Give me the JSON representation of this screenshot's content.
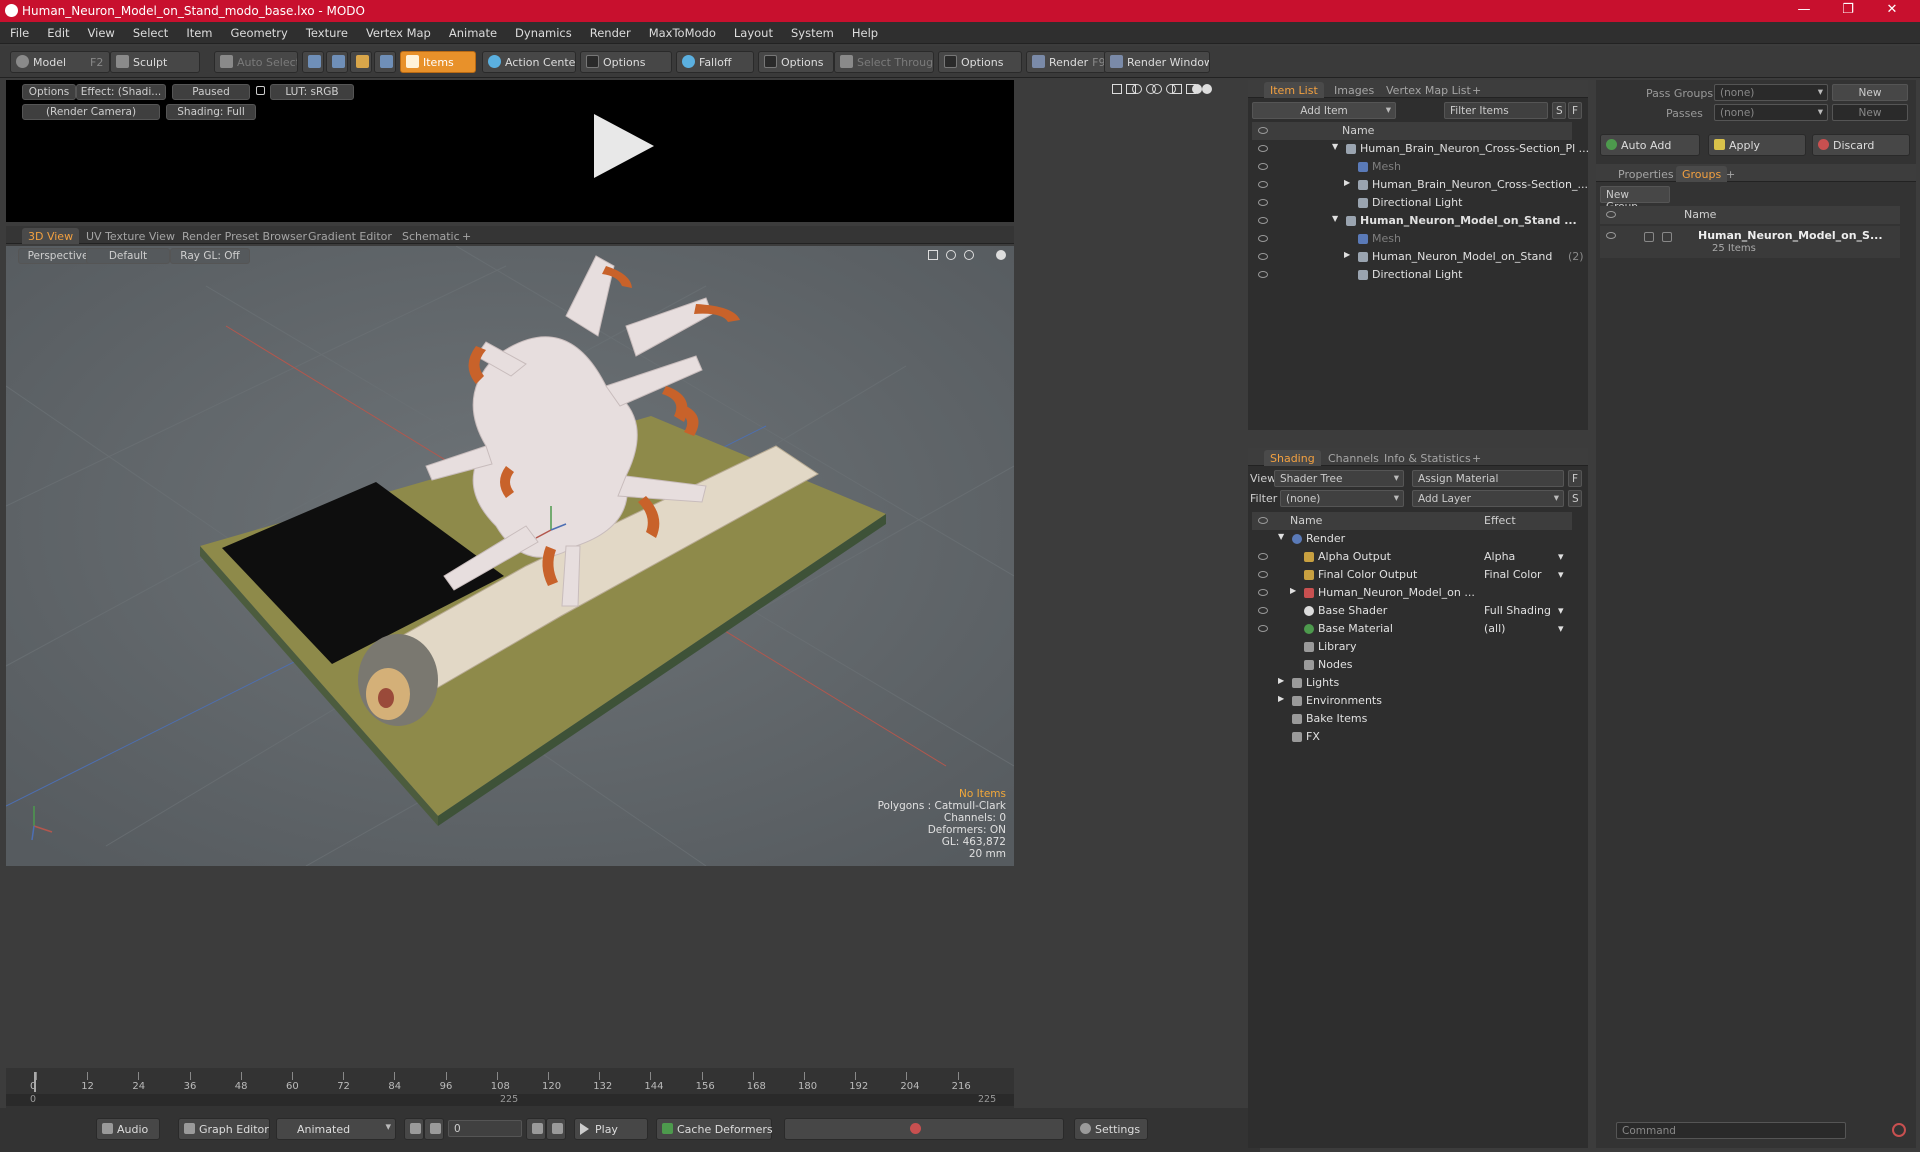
{
  "window": {
    "title": "Human_Neuron_Model_on_Stand_modo_base.lxo - MODO",
    "minimize": "—",
    "maximize": "❐",
    "close": "✕"
  },
  "menu": [
    "File",
    "Edit",
    "View",
    "Select",
    "Item",
    "Geometry",
    "Texture",
    "Vertex Map",
    "Animate",
    "Dynamics",
    "Render",
    "MaxToModo",
    "Layout",
    "System",
    "Help"
  ],
  "toolbar": {
    "model": "Model",
    "model_key": "F2",
    "sculpt": "Sculpt",
    "auto_select": "Auto Select",
    "items": "Items",
    "action_center": "Action Center",
    "options1": "Options",
    "falloff": "Falloff",
    "options2": "Options",
    "select_through": "Select Through",
    "options3": "Options",
    "render": "Render",
    "render_key": "F9",
    "render_window": "Render Window"
  },
  "preview": {
    "options": "Options",
    "effect": "Effect: (Shadi...",
    "paused": "Paused",
    "lut": "LUT: sRGB",
    "camera": "(Render Camera)",
    "shading": "Shading: Full"
  },
  "view_tabs": [
    "3D View",
    "UV Texture View",
    "Render Preset Browser",
    "Gradient Editor",
    "Schematic"
  ],
  "viewport": {
    "perspective": "Perspective",
    "default": "Default",
    "raygl": "Ray GL: Off",
    "info": {
      "no_items": "No Items",
      "polygons": "Polygons : Catmull-Clark",
      "channels": "Channels: 0",
      "deformers": "Deformers: ON",
      "gl": "GL: 463,872",
      "scale": "20 mm"
    },
    "colors": {
      "no_items": "#f2a83a"
    }
  },
  "timeline": {
    "ticks": [
      "0",
      "12",
      "24",
      "36",
      "48",
      "60",
      "72",
      "84",
      "96",
      "108",
      "120",
      "132",
      "144",
      "156",
      "168",
      "180",
      "192",
      "204",
      "216"
    ],
    "sub_left": "0",
    "sub_mid": "225",
    "sub_right": "225"
  },
  "bottombar": {
    "audio": "Audio",
    "graph_editor": "Graph Editor",
    "animated": "Animated",
    "frame": "0",
    "play": "Play",
    "cache": "Cache Deformers",
    "settings": "Settings"
  },
  "item_list": {
    "tabs": [
      "Item List",
      "Images",
      "Vertex Map List"
    ],
    "add_item": "Add Item",
    "filter": "Filter Items",
    "s": "S",
    "f": "F",
    "col_name": "Name",
    "rows": [
      {
        "label": "Human_Brain_Neuron_Cross-Section_Pl ...",
        "indent": 0,
        "expand": "▼",
        "bold": false,
        "dim": false
      },
      {
        "label": "Mesh",
        "indent": 1,
        "expand": "",
        "bold": false,
        "dim": true
      },
      {
        "label": "Human_Brain_Neuron_Cross-Section_...",
        "indent": 1,
        "expand": "▶",
        "bold": false,
        "dim": false
      },
      {
        "label": "Directional Light",
        "indent": 1,
        "expand": "",
        "bold": false,
        "dim": false
      },
      {
        "label": "Human_Neuron_Model_on_Stand ...",
        "indent": 0,
        "expand": "▼",
        "bold": true,
        "dim": false
      },
      {
        "label": "Mesh",
        "indent": 1,
        "expand": "",
        "bold": false,
        "dim": true
      },
      {
        "label": "Human_Neuron_Model_on_Stand",
        "suffix": "(2)",
        "indent": 1,
        "expand": "▶",
        "bold": false,
        "dim": false
      },
      {
        "label": "Directional Light",
        "indent": 1,
        "expand": "",
        "bold": false,
        "dim": false
      }
    ]
  },
  "shading": {
    "tabs": [
      "Shading",
      "Channels",
      "Info & Statistics"
    ],
    "view_label": "View",
    "view_value": "Shader Tree",
    "assign": "Assign Material",
    "f": "F",
    "filter_label": "Filter",
    "filter_value": "(none)",
    "add_layer": "Add Layer",
    "s": "S",
    "col_name": "Name",
    "col_effect": "Effect",
    "rows": [
      {
        "label": "Render",
        "effect": "",
        "indent": 0,
        "expand": "▼",
        "eye": false
      },
      {
        "label": "Alpha Output",
        "effect": "Alpha",
        "indent": 1,
        "expand": "",
        "eye": true
      },
      {
        "label": "Final Color Output",
        "effect": "Final Color",
        "indent": 1,
        "expand": "",
        "eye": true
      },
      {
        "label": "Human_Neuron_Model_on ...",
        "effect": "",
        "indent": 1,
        "expand": "▶",
        "eye": true
      },
      {
        "label": "Base Shader",
        "effect": "Full Shading",
        "indent": 1,
        "expand": "",
        "eye": true
      },
      {
        "label": "Base Material",
        "effect": "(all)",
        "indent": 1,
        "expand": "",
        "eye": true
      },
      {
        "label": "Library",
        "effect": "",
        "indent": 1,
        "expand": "",
        "eye": false
      },
      {
        "label": "Nodes",
        "effect": "",
        "indent": 1,
        "expand": "",
        "eye": false
      },
      {
        "label": "Lights",
        "effect": "",
        "indent": 0,
        "expand": "▶",
        "eye": false
      },
      {
        "label": "Environments",
        "effect": "",
        "indent": 0,
        "expand": "▶",
        "eye": false
      },
      {
        "label": "Bake Items",
        "effect": "",
        "indent": 0,
        "expand": "",
        "eye": false
      },
      {
        "label": "FX",
        "effect": "",
        "indent": 0,
        "expand": "",
        "eye": false
      }
    ]
  },
  "groups": {
    "pass_groups_label": "Pass Groups",
    "pass_groups_value": "(none)",
    "new1": "New",
    "passes_label": "Passes",
    "passes_value": "(none)",
    "new2": "New",
    "auto_add": "Auto Add",
    "apply": "Apply",
    "discard": "Discard",
    "tabs": [
      "Properties",
      "Groups"
    ],
    "new_group": "New Group",
    "col_name": "Name",
    "group_name": "Human_Neuron_Model_on_S...",
    "group_count": "25 Items"
  },
  "command": {
    "placeholder": "Command"
  }
}
